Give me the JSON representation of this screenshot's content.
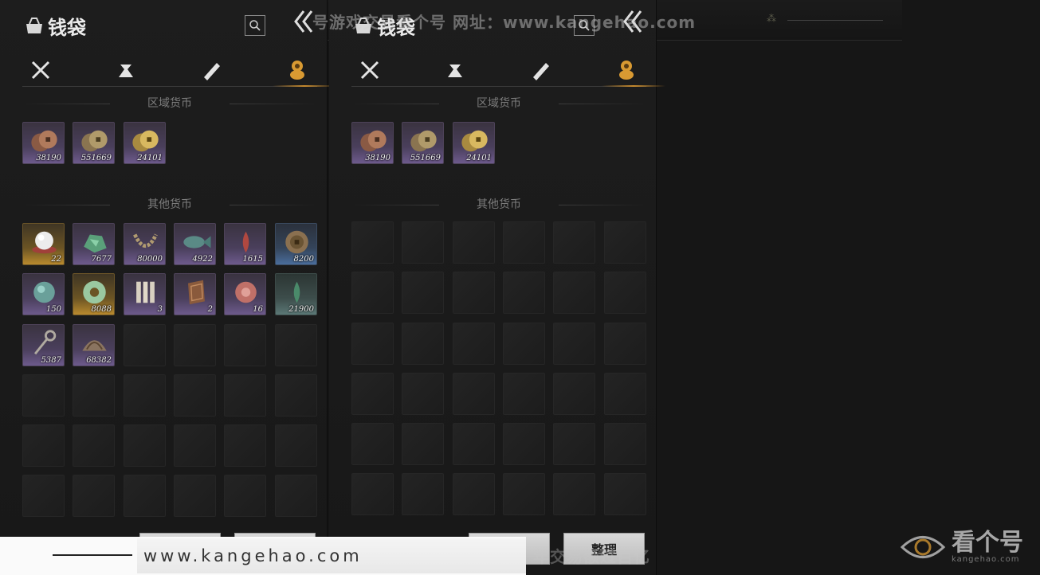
{
  "topbar": {
    "deco": "⁂"
  },
  "watermark": {
    "top": "号游戏交易看个号   网址：www.kangehao.com",
    "bottom": "看个号专业网易游戏八年  年交易额过百亿"
  },
  "panels": [
    {
      "title": "钱袋",
      "tabs": [
        {
          "icon": "crossed-swords-icon",
          "active": false
        },
        {
          "icon": "pouch-icon",
          "active": false
        },
        {
          "icon": "scroll-icon",
          "active": false
        },
        {
          "icon": "coin-stack-icon",
          "active": true
        }
      ],
      "sections": {
        "regional": "区域货币",
        "other": "其他货币"
      },
      "regional_items": [
        {
          "icon": "copper-coins-icon",
          "count": "38190",
          "rarity": "purple"
        },
        {
          "icon": "bronze-coins-icon",
          "count": "551669",
          "rarity": "purple"
        },
        {
          "icon": "gold-coins-icon",
          "count": "24101",
          "rarity": "purple"
        }
      ],
      "other_items": [
        {
          "icon": "pearl-icon",
          "count": "22",
          "rarity": "gold"
        },
        {
          "icon": "jade-ore-icon",
          "count": "7677",
          "rarity": "purple"
        },
        {
          "icon": "necklace-icon",
          "count": "80000",
          "rarity": "purple"
        },
        {
          "icon": "jade-fish-icon",
          "count": "4922",
          "rarity": "purple"
        },
        {
          "icon": "red-feather-icon",
          "count": "1615",
          "rarity": "purple"
        },
        {
          "icon": "bronze-medal-icon",
          "count": "8200",
          "rarity": "blue"
        },
        {
          "icon": "jade-stone-icon",
          "count": "150",
          "rarity": "purple"
        },
        {
          "icon": "jade-ring-icon",
          "count": "8088",
          "rarity": "gold"
        },
        {
          "icon": "bamboo-slips-icon",
          "count": "3",
          "rarity": "purple"
        },
        {
          "icon": "wooden-token-icon",
          "count": "2",
          "rarity": "purple"
        },
        {
          "icon": "red-orb-icon",
          "count": "16",
          "rarity": "purple"
        },
        {
          "icon": "green-feather-icon",
          "count": "21900",
          "rarity": "teal"
        },
        {
          "icon": "key-icon",
          "count": "5387",
          "rarity": "purple"
        },
        {
          "icon": "shell-icon",
          "count": "68382",
          "rarity": "purple"
        }
      ],
      "buttons": [
        "",
        ""
      ]
    },
    {
      "title": "钱袋",
      "tabs": [
        {
          "icon": "crossed-swords-icon",
          "active": false
        },
        {
          "icon": "pouch-icon",
          "active": false
        },
        {
          "icon": "scroll-icon",
          "active": false
        },
        {
          "icon": "coin-stack-icon",
          "active": true
        }
      ],
      "sections": {
        "regional": "区域货币",
        "other": "其他货币"
      },
      "regional_items": [
        {
          "icon": "copper-coins-icon",
          "count": "38190",
          "rarity": "purple"
        },
        {
          "icon": "bronze-coins-icon",
          "count": "551669",
          "rarity": "purple"
        },
        {
          "icon": "gold-coins-icon",
          "count": "24101",
          "rarity": "purple"
        }
      ],
      "other_items": [],
      "buttons": [
        "",
        "整理"
      ]
    }
  ],
  "footer": {
    "url": "www.kangehao.com"
  },
  "corner_logo": {
    "name": "看个号",
    "domain": "kangehao.com"
  },
  "colors": {
    "accent": "#c68a2e",
    "purple": "#6d5a8c",
    "gold": "#b98a2e"
  }
}
